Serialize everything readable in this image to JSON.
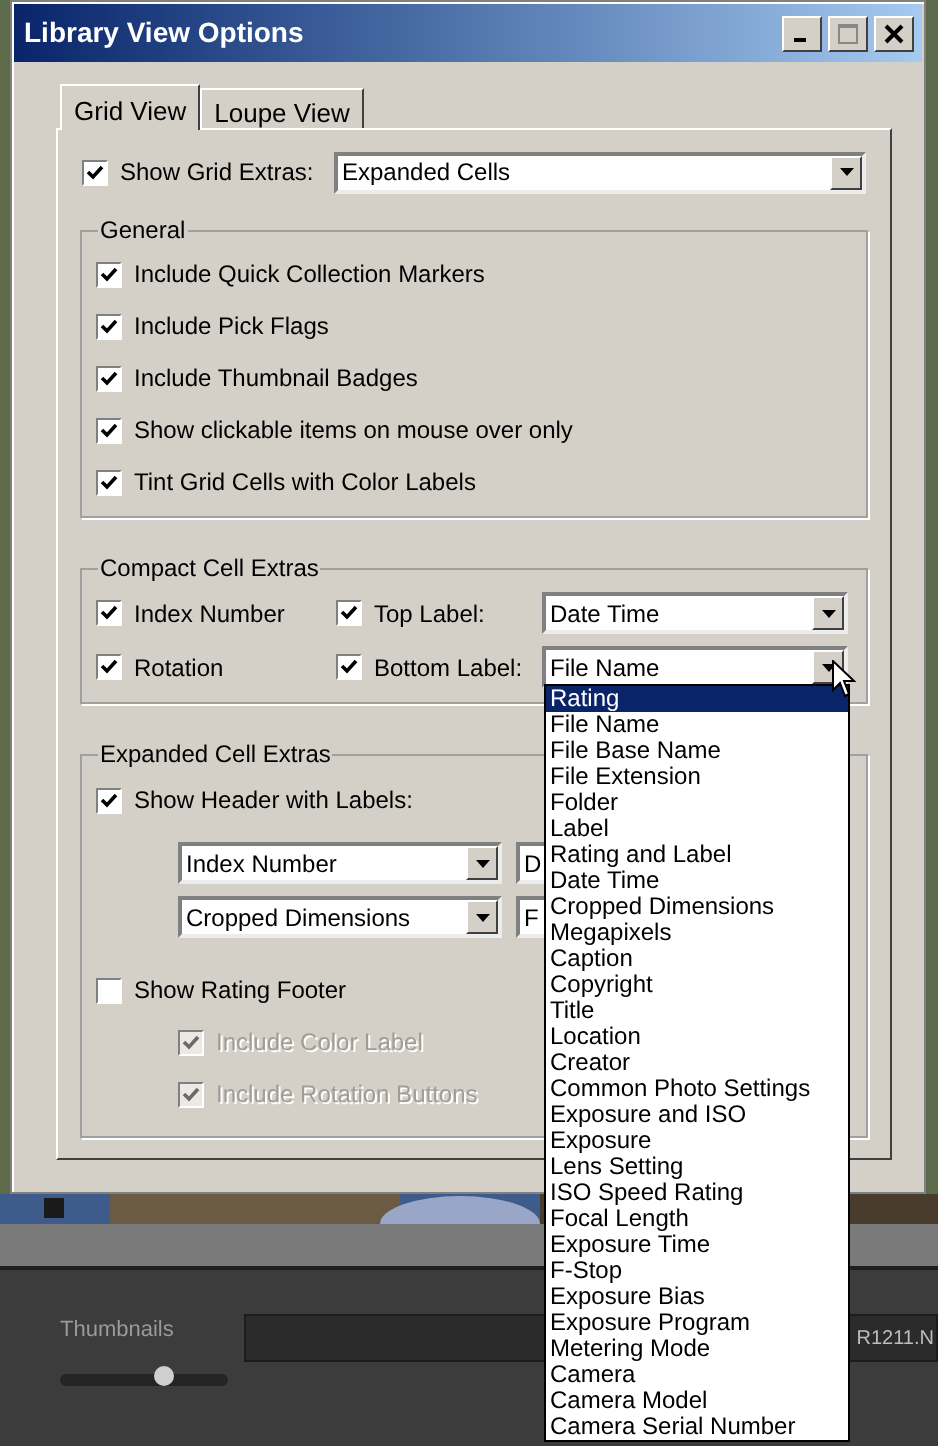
{
  "window": {
    "title": "Library View Options"
  },
  "tabs": [
    {
      "label": "Grid View",
      "selected": true
    },
    {
      "label": "Loupe View",
      "selected": false
    }
  ],
  "show_grid_extras": {
    "label": "Show Grid Extras:",
    "checked": true,
    "value": "Expanded Cells"
  },
  "general": {
    "title": "General",
    "items": [
      {
        "label": "Include Quick Collection Markers",
        "checked": true
      },
      {
        "label": "Include Pick Flags",
        "checked": true
      },
      {
        "label": "Include Thumbnail Badges",
        "checked": true
      },
      {
        "label": "Show clickable items on mouse over only",
        "checked": true
      },
      {
        "label": "Tint Grid Cells with Color Labels",
        "checked": true
      }
    ]
  },
  "compact_cell_extras": {
    "title": "Compact Cell Extras",
    "rows": [
      {
        "option": {
          "label": "Index Number",
          "checked": true
        },
        "label_option": {
          "label": "Top Label:",
          "checked": true,
          "value": "Date Time"
        }
      },
      {
        "option": {
          "label": "Rotation",
          "checked": true
        },
        "label_option": {
          "label": "Bottom Label:",
          "checked": true,
          "value": "File Name"
        }
      }
    ]
  },
  "expanded_cell_extras": {
    "title": "Expanded Cell Extras",
    "show_header": {
      "label": "Show Header with Labels:",
      "checked": true
    },
    "header_selects": [
      {
        "column_1": "Index Number",
        "column_2": "D"
      },
      {
        "column_1": "Cropped Dimensions",
        "column_2": "F"
      }
    ],
    "rating_footer": {
      "label": "Show Rating Footer",
      "checked": false
    },
    "footer_options": [
      {
        "label": "Include Color Label",
        "checked": true,
        "disabled": true
      },
      {
        "label": "Include Rotation Buttons",
        "checked": true,
        "disabled": true
      }
    ]
  },
  "dropdown_list": {
    "items": [
      {
        "label": "Rating",
        "selected": true
      },
      {
        "label": "File Name",
        "selected": false
      },
      {
        "label": "File Base Name",
        "selected": false
      },
      {
        "label": "File Extension",
        "selected": false
      },
      {
        "label": "Folder",
        "selected": false
      },
      {
        "label": "Label",
        "selected": false
      },
      {
        "label": "Rating and Label",
        "selected": false
      },
      {
        "label": "Date Time",
        "selected": false
      },
      {
        "label": "Cropped Dimensions",
        "selected": false
      },
      {
        "label": "Megapixels",
        "selected": false
      },
      {
        "label": "Caption",
        "selected": false
      },
      {
        "label": "Copyright",
        "selected": false
      },
      {
        "label": "Title",
        "selected": false
      },
      {
        "label": "Location",
        "selected": false
      },
      {
        "label": "Creator",
        "selected": false
      },
      {
        "label": "Common Photo Settings",
        "selected": false
      },
      {
        "label": "Exposure and ISO",
        "selected": false
      },
      {
        "label": "Exposure",
        "selected": false
      },
      {
        "label": "Lens Setting",
        "selected": false
      },
      {
        "label": "ISO Speed Rating",
        "selected": false
      },
      {
        "label": "Focal Length",
        "selected": false
      },
      {
        "label": "Exposure Time",
        "selected": false
      },
      {
        "label": "F-Stop",
        "selected": false
      },
      {
        "label": "Exposure Bias",
        "selected": false
      },
      {
        "label": "Exposure Program",
        "selected": false
      },
      {
        "label": "Metering Mode",
        "selected": false
      },
      {
        "label": "Camera",
        "selected": false
      },
      {
        "label": "Camera Model",
        "selected": false
      },
      {
        "label": "Camera Serial Number",
        "selected": false
      }
    ]
  },
  "toolbar": {
    "thumbnails_label": "Thumbnails",
    "thumbnail_size": {
      "level": 0.62
    },
    "file_name": "R1211.N"
  }
}
